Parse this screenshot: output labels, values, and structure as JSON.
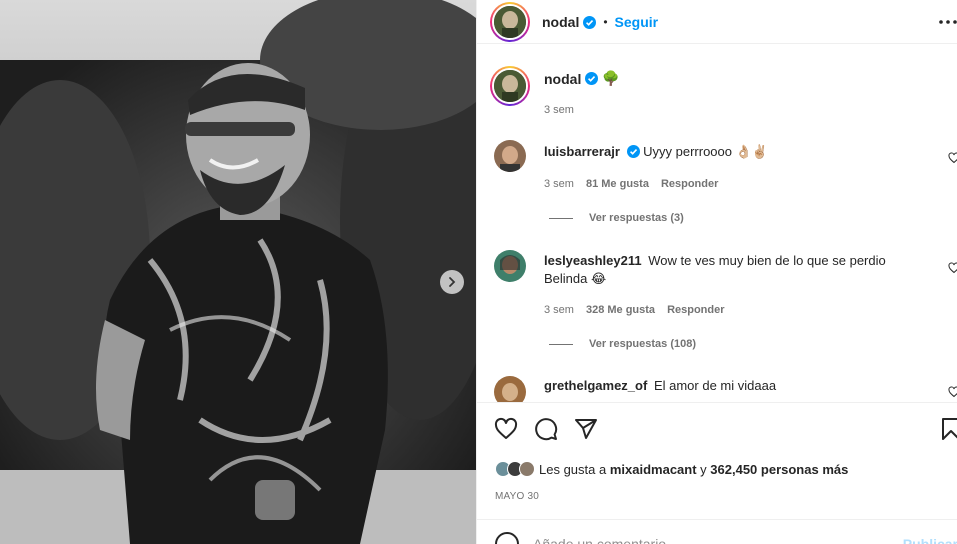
{
  "post": {
    "author": "nodal",
    "follow_label": "Seguir",
    "separator": "•",
    "caption_emoji": "🌳",
    "caption_time": "3 sem",
    "icons": {
      "verified": "verified-badge-icon",
      "more": "more-horizontal-icon",
      "carousel_next": "chevron-right-icon"
    }
  },
  "comments": [
    {
      "username": "luisbarrerajr",
      "verified": true,
      "text": "Uyyy perrroooo 👌🏼✌🏼",
      "time": "3 sem",
      "likes": "81 Me gusta",
      "reply_label": "Responder",
      "view_replies": "Ver respuestas (3)",
      "avatar_color": "#8a6a52"
    },
    {
      "username": "leslyeashley211",
      "verified": false,
      "text": "Wow te ves muy bien de lo que se perdio Belinda 😂",
      "time": "3 sem",
      "likes": "328 Me gusta",
      "reply_label": "Responder",
      "view_replies": "Ver respuestas (108)",
      "avatar_color": "#3f7f6a"
    },
    {
      "username": "grethelgamez_of",
      "verified": false,
      "text": "El amor de mi vidaaa",
      "avatar_color": "#9a6a3e"
    }
  ],
  "actions": {
    "icons": [
      "heart-icon",
      "comment-icon",
      "share-icon",
      "bookmark-icon"
    ],
    "likes_prefix": "Les gusta a",
    "likes_user": "mixaidmacant",
    "likes_and": "y",
    "likes_count": "362,450 personas más",
    "date": "MAYO 30"
  },
  "add_comment": {
    "placeholder": "Añade un comentario...",
    "post_label": "Publicar"
  },
  "colors": {
    "accent": "#0095f6",
    "muted": "#737373",
    "post_disabled": "#b2dffc"
  }
}
